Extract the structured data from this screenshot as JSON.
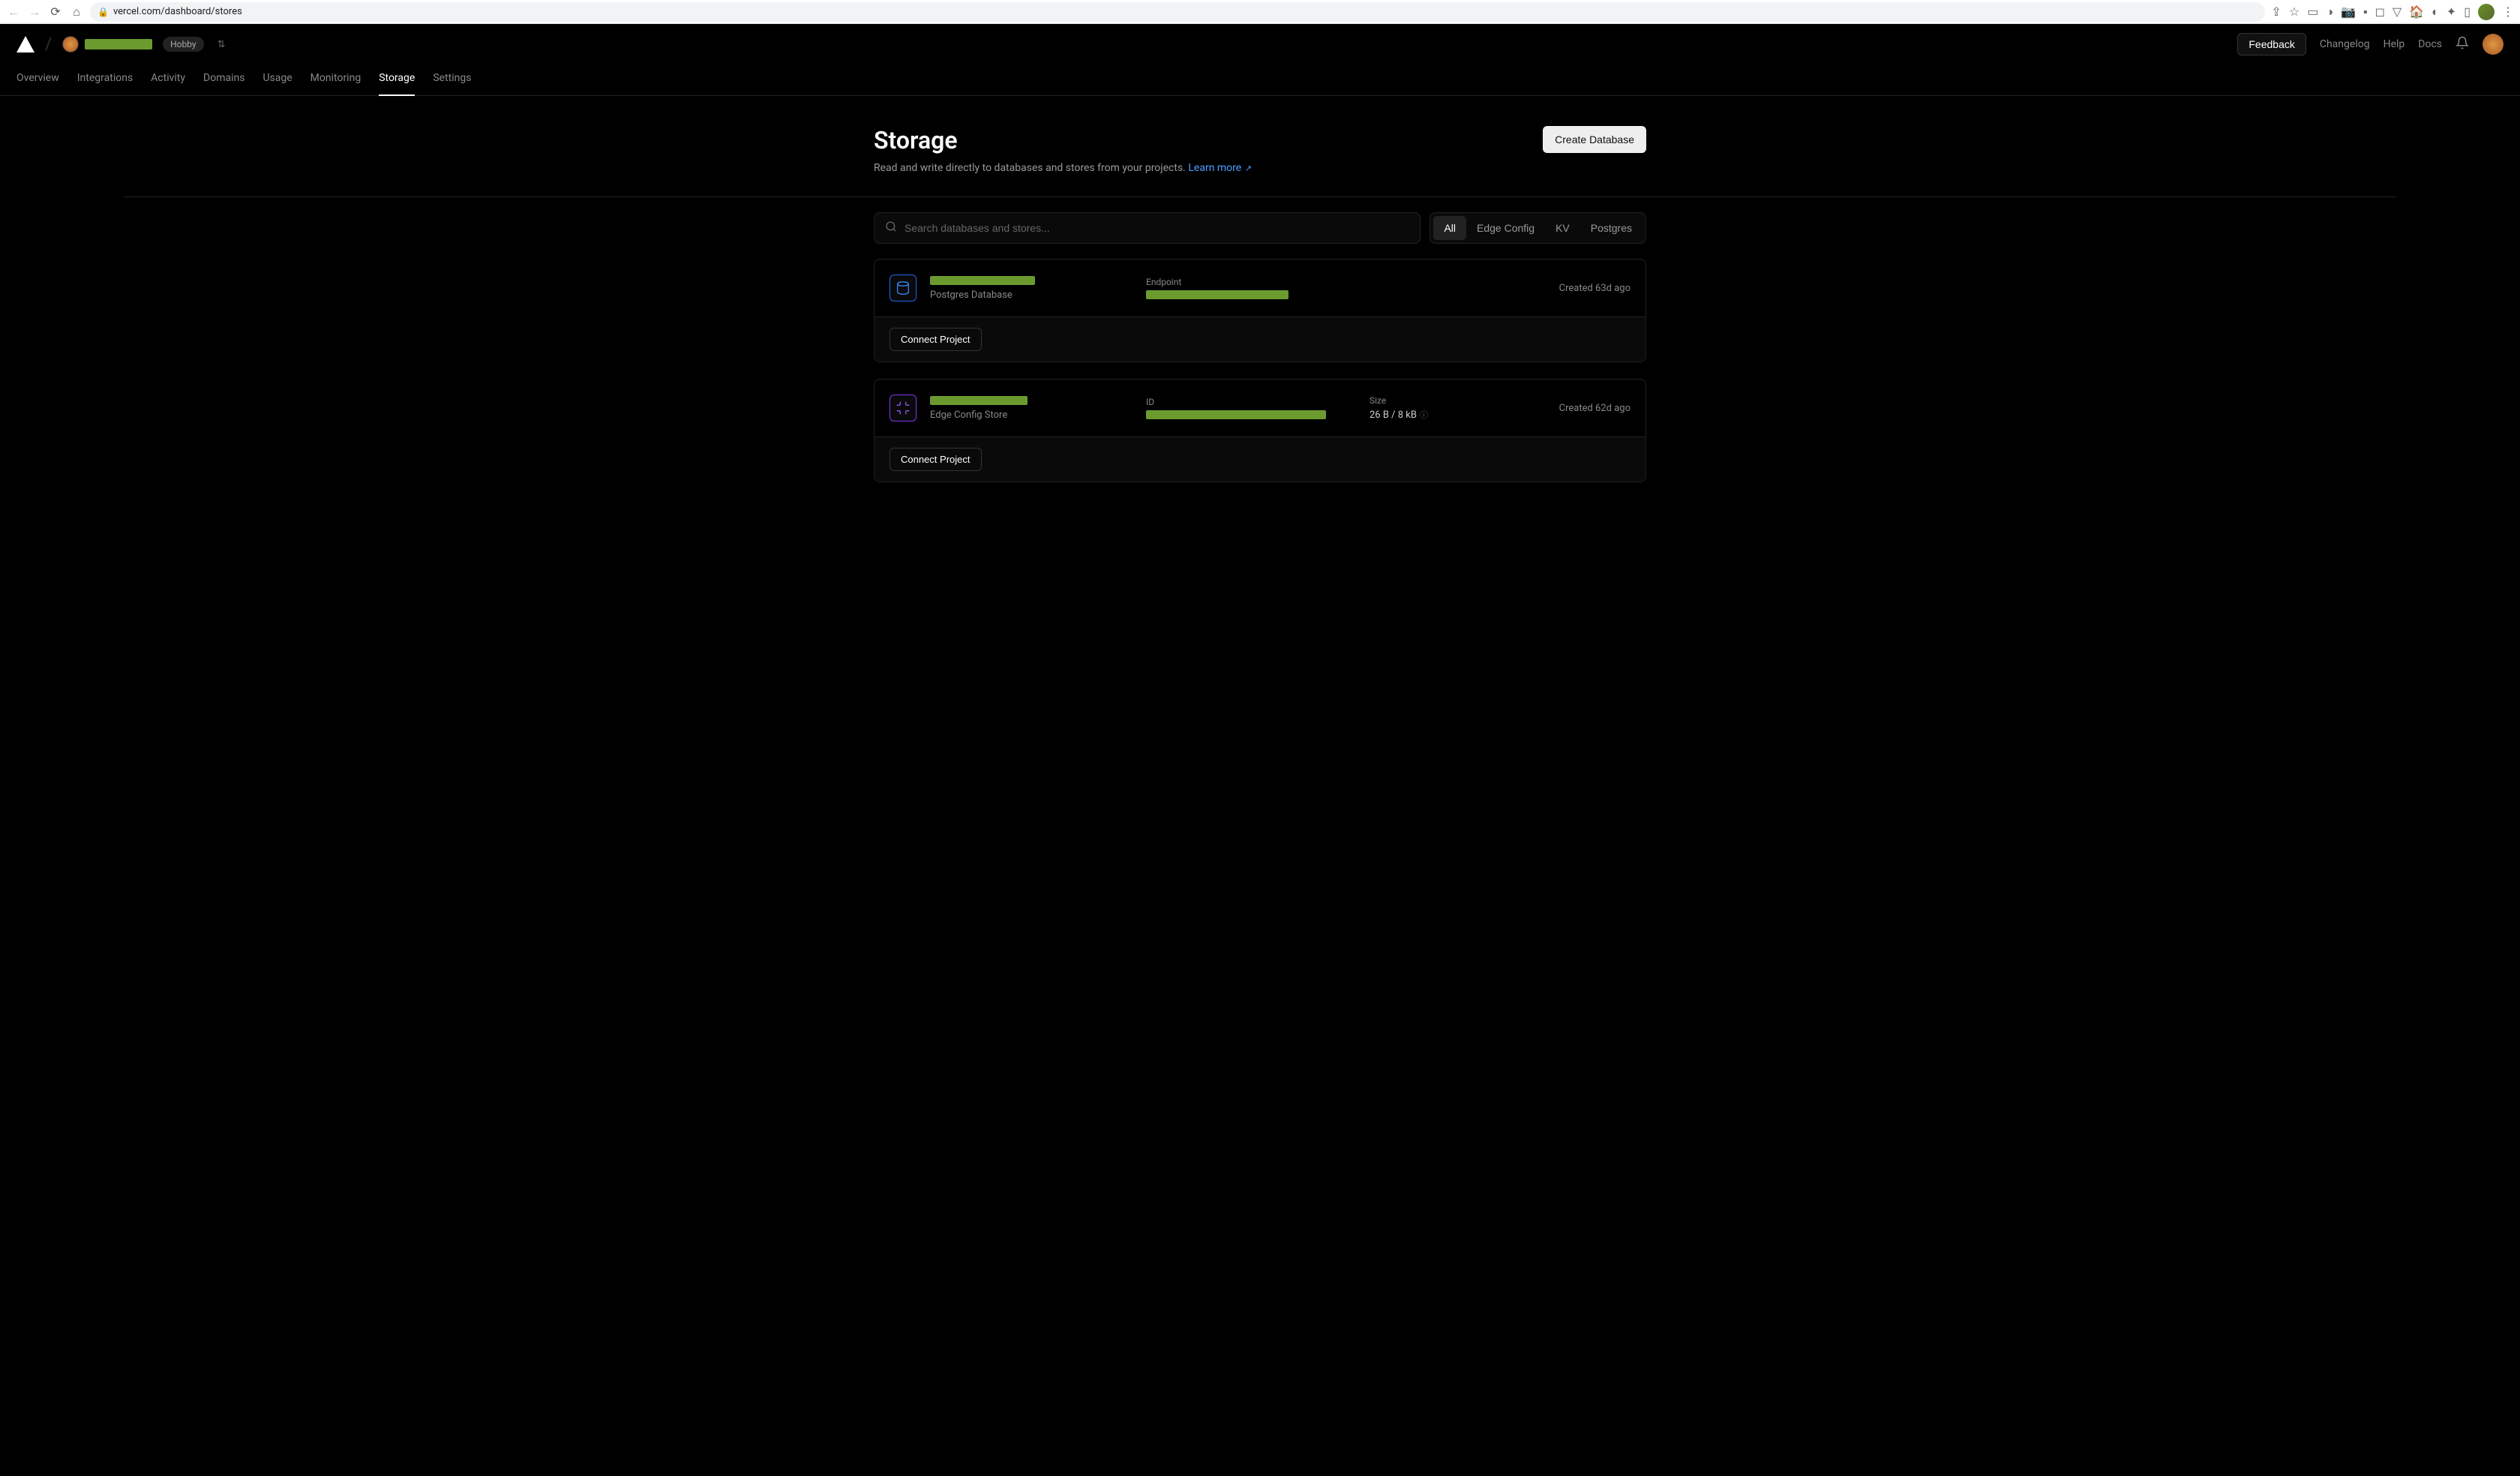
{
  "browser": {
    "url": "vercel.com/dashboard/stores"
  },
  "header": {
    "plan": "Hobby",
    "feedback": "Feedback",
    "links": [
      "Changelog",
      "Help",
      "Docs"
    ]
  },
  "tabs": [
    "Overview",
    "Integrations",
    "Activity",
    "Domains",
    "Usage",
    "Monitoring",
    "Storage",
    "Settings"
  ],
  "activeTab": "Storage",
  "page": {
    "title": "Storage",
    "subtitle": "Read and write directly to databases and stores from your projects.",
    "learn": "Learn more",
    "create": "Create Database"
  },
  "search": {
    "placeholder": "Search databases and stores..."
  },
  "filters": [
    "All",
    "Edge Config",
    "KV",
    "Postgres"
  ],
  "activeFilter": "All",
  "stores": [
    {
      "type": "Postgres Database",
      "icon": "pg",
      "metaLabel": "Endpoint",
      "created": "Created 63d ago",
      "connect": "Connect Project",
      "nameW": 140,
      "valW": 190
    },
    {
      "type": "Edge Config Store",
      "icon": "ec",
      "metaLabel": "ID",
      "sizeLabel": "Size",
      "size": "26 B / 8 kB",
      "created": "Created 62d ago",
      "connect": "Connect Project",
      "nameW": 130,
      "valW": 240
    }
  ]
}
